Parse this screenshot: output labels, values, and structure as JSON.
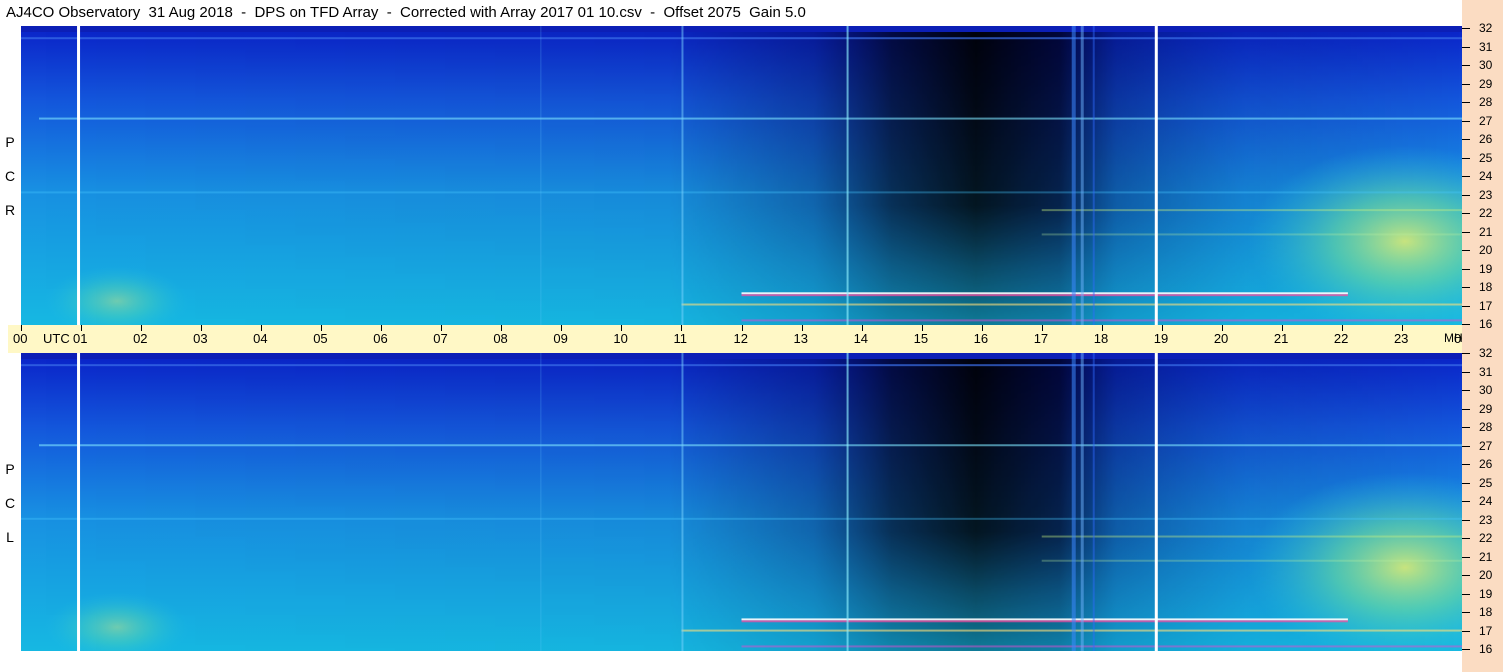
{
  "title": "AJ4CO Observatory  31 Aug 2018  -  DPS on TFD Array  -  Corrected with Array 2017 01 10.csv  -  Offset 2075  Gain 5.0",
  "chart_data": {
    "type": "heatmap",
    "panels": [
      {
        "name": "rcp",
        "label_letters": [
          "R",
          "C",
          "P"
        ]
      },
      {
        "name": "lcp",
        "label_letters": [
          "L",
          "C",
          "P"
        ]
      }
    ],
    "x": {
      "tick_labels": [
        "00",
        "01",
        "02",
        "03",
        "04",
        "05",
        "06",
        "07",
        "08",
        "09",
        "10",
        "11",
        "12",
        "13",
        "14",
        "15",
        "16",
        "17",
        "18",
        "19",
        "20",
        "21",
        "22",
        "23",
        "00"
      ],
      "unit_label": "UTC",
      "range_hours": [
        0,
        24
      ]
    },
    "y": {
      "tick_labels": [
        "16",
        "17",
        "18",
        "19",
        "20",
        "21",
        "22",
        "23",
        "24",
        "25",
        "26",
        "27",
        "28",
        "29",
        "30",
        "31",
        "32"
      ],
      "unit_label": "MHz",
      "range_mhz": [
        16,
        32
      ]
    },
    "colormap": [
      "#000000",
      "#00007a",
      "#0a2fd6",
      "#1e7ce8",
      "#14b4e4",
      "#1fd2dc",
      "#6fe6a8",
      "#d8f070",
      "#ffd24a",
      "#ff4aa0",
      "#ffffff"
    ],
    "features": {
      "white_time_markers_hours": [
        0.95,
        18.9
      ],
      "dark_region_hours": [
        14.5,
        17.3
      ],
      "bright_band_hours": [
        20.5,
        24
      ]
    }
  }
}
